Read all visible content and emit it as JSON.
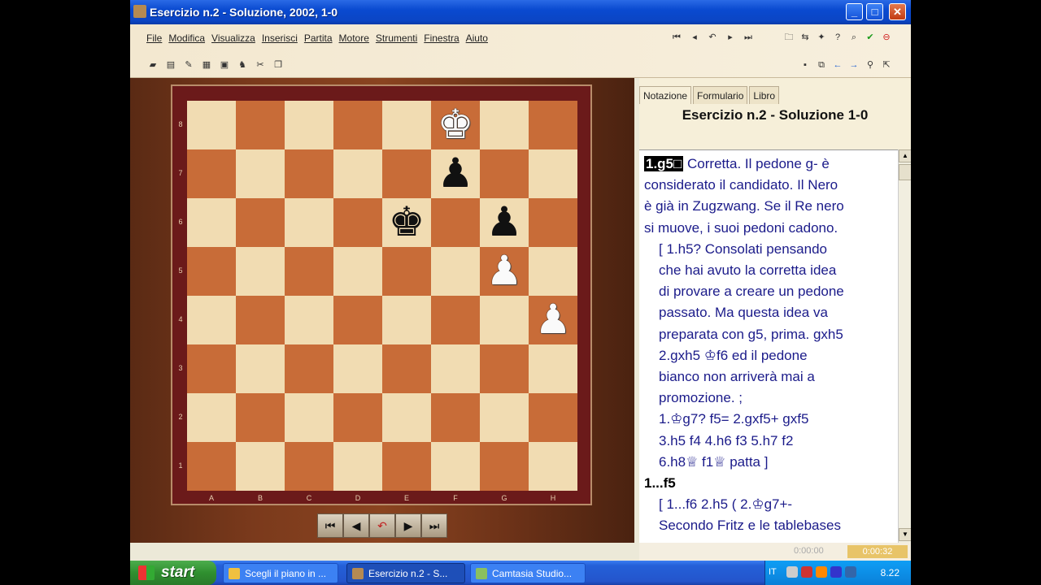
{
  "window": {
    "title": "Esercizio n.2 - Soluzione,  2002, 1-0",
    "minimize": "_",
    "maximize": "□",
    "close": "✕"
  },
  "menu": [
    "File",
    "Modifica",
    "Visualizza",
    "Inserisci",
    "Partita",
    "Motore",
    "Strumenti",
    "Finestra",
    "Aiuto"
  ],
  "board": {
    "ranks": [
      "8",
      "7",
      "6",
      "5",
      "4",
      "3",
      "2",
      "1"
    ],
    "files": [
      "A",
      "B",
      "C",
      "D",
      "E",
      "F",
      "G",
      "H"
    ],
    "pieces": [
      {
        "square": "f8",
        "color": "w",
        "glyph": "♚",
        "name": "white-king"
      },
      {
        "square": "f7",
        "color": "b",
        "glyph": "♟",
        "name": "black-pawn-f7"
      },
      {
        "square": "e6",
        "color": "b",
        "glyph": "♚",
        "name": "black-king"
      },
      {
        "square": "g6",
        "color": "b",
        "glyph": "♟",
        "name": "black-pawn-g6"
      },
      {
        "square": "g5",
        "color": "w",
        "glyph": "♟",
        "name": "white-pawn-g5"
      },
      {
        "square": "h4",
        "color": "w",
        "glyph": "♟",
        "name": "white-pawn-h4"
      }
    ]
  },
  "nav_buttons": [
    "⏮",
    "◀",
    "↶",
    "▶",
    "⏭"
  ],
  "tabs": [
    "Notazione",
    "Formulario",
    "Libro"
  ],
  "game_title": "Esercizio n.2 - Soluzione  1-0",
  "notation": {
    "l1_move": "1.g5□",
    "l1_text": "Corretta. Il pedone g- è",
    "l2": "considerato il candidato. Il Nero",
    "l3": "è già in Zugzwang. Se il Re nero",
    "l4": "si muove, i suoi pedoni cadono.",
    "l5": "[ 1.h5? Consolati pensando",
    "l6": "che hai avuto la corretta idea",
    "l7": "di provare a creare un pedone",
    "l8": "passato. Ma questa idea va",
    "l9": "preparata con g5, prima.  gxh5",
    "l10": "2.gxh5  ♔f6 ed il pedone",
    "l11": "bianco non arriverà mai a",
    "l12": "promozione. ;",
    "l13": "1.♔g7?  f5=  2.gxf5+  gxf5",
    "l14": "3.h5  f4  4.h6  f3  5.h7  f2",
    "l15": "6.h8♕  f1♕ patta ]",
    "l16": "1...f5",
    "l17": "[ 1...f6  2.h5  ( 2.♔g7+-",
    "l18": "Secondo Fritz e le tablebases"
  },
  "status": {
    "time1": "0:00:00",
    "time2": "0:00:32"
  },
  "taskbar": {
    "start": "start",
    "items": [
      "Scegli il piano in ...",
      "Esercizio n.2 - S...",
      "Camtasia Studio..."
    ],
    "lang": "IT",
    "clock": "8.22"
  },
  "colors": {
    "light_square": "#f1dcb2",
    "dark_square": "#c86c38",
    "frame": "#6b1a1a",
    "notation_text": "#1b1b8a"
  }
}
